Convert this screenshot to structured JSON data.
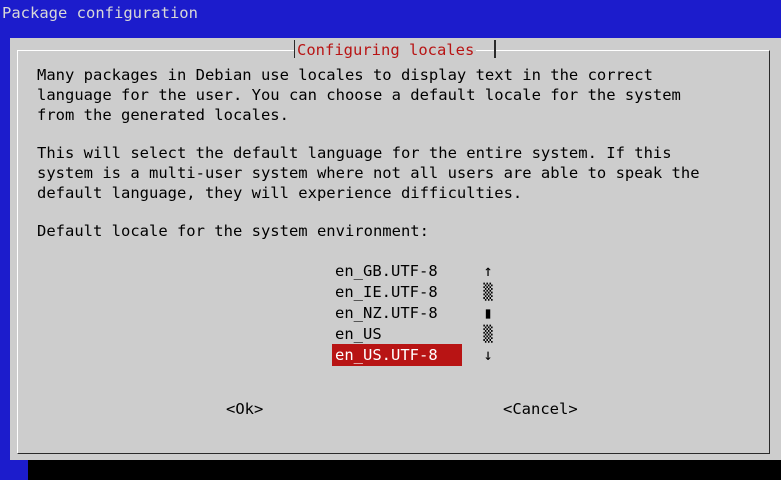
{
  "window": {
    "title": "Package configuration"
  },
  "dialog": {
    "title": "Configuring locales",
    "paragraph1": [
      "Many packages in Debian use locales to display text in the correct",
      "language for the user. You can choose a default locale for the system",
      "from the generated locales."
    ],
    "paragraph2": [
      "This will select the default language for the entire system. If this",
      "system is a multi-user system where not all users are able to speak the",
      "default language, they will experience difficulties."
    ],
    "prompt": "Default locale for the system environment:",
    "locales": [
      "en_GB.UTF-8",
      "en_IE.UTF-8",
      "en_NZ.UTF-8",
      "en_US",
      "en_US.UTF-8"
    ],
    "selected_locale": "en_US.UTF-8",
    "scrollbar": {
      "up": "↑",
      "track": "▒",
      "thumb": "▮",
      "down": "↓"
    },
    "buttons": {
      "ok": "<Ok>",
      "cancel": "<Cancel>"
    }
  }
}
